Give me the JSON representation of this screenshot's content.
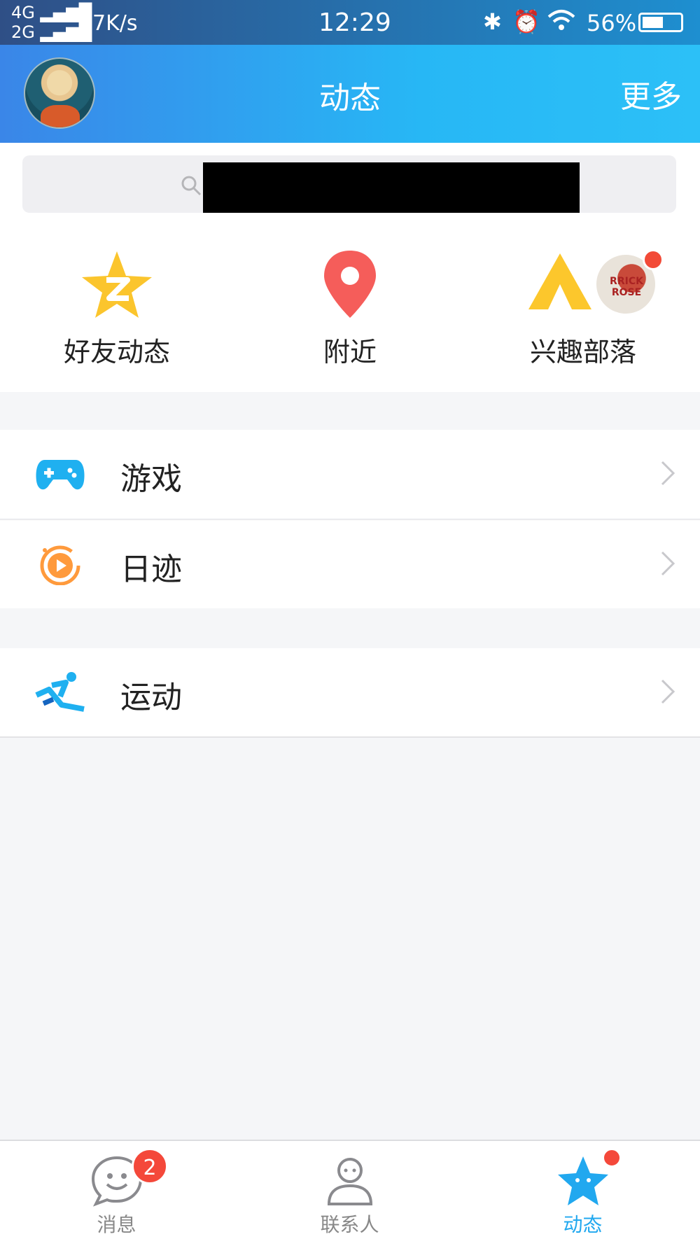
{
  "status_bar": {
    "network_top": "4G",
    "network_bottom": "2G",
    "speed": "7K/s",
    "time": "12:29",
    "battery_text": "56%",
    "battery_level": 0.56
  },
  "header": {
    "title": "动态",
    "more_label": "更多"
  },
  "quick_actions": [
    {
      "label": "好友动态",
      "icon": "qzone-star-icon"
    },
    {
      "label": "附近",
      "icon": "location-pin-icon"
    },
    {
      "label": "兴趣部落",
      "icon": "tribe-tent-icon"
    }
  ],
  "list": {
    "game_label": "游戏",
    "diary_label": "日迹",
    "sport_label": "运动"
  },
  "tabs": {
    "messages_label": "消息",
    "messages_badge": "2",
    "contacts_label": "联系人",
    "dynamic_label": "动态"
  },
  "colors": {
    "accent": "#21a8ef",
    "badge": "#f4483a",
    "header_start": "#3a86e8",
    "header_end": "#2cc0f7"
  }
}
